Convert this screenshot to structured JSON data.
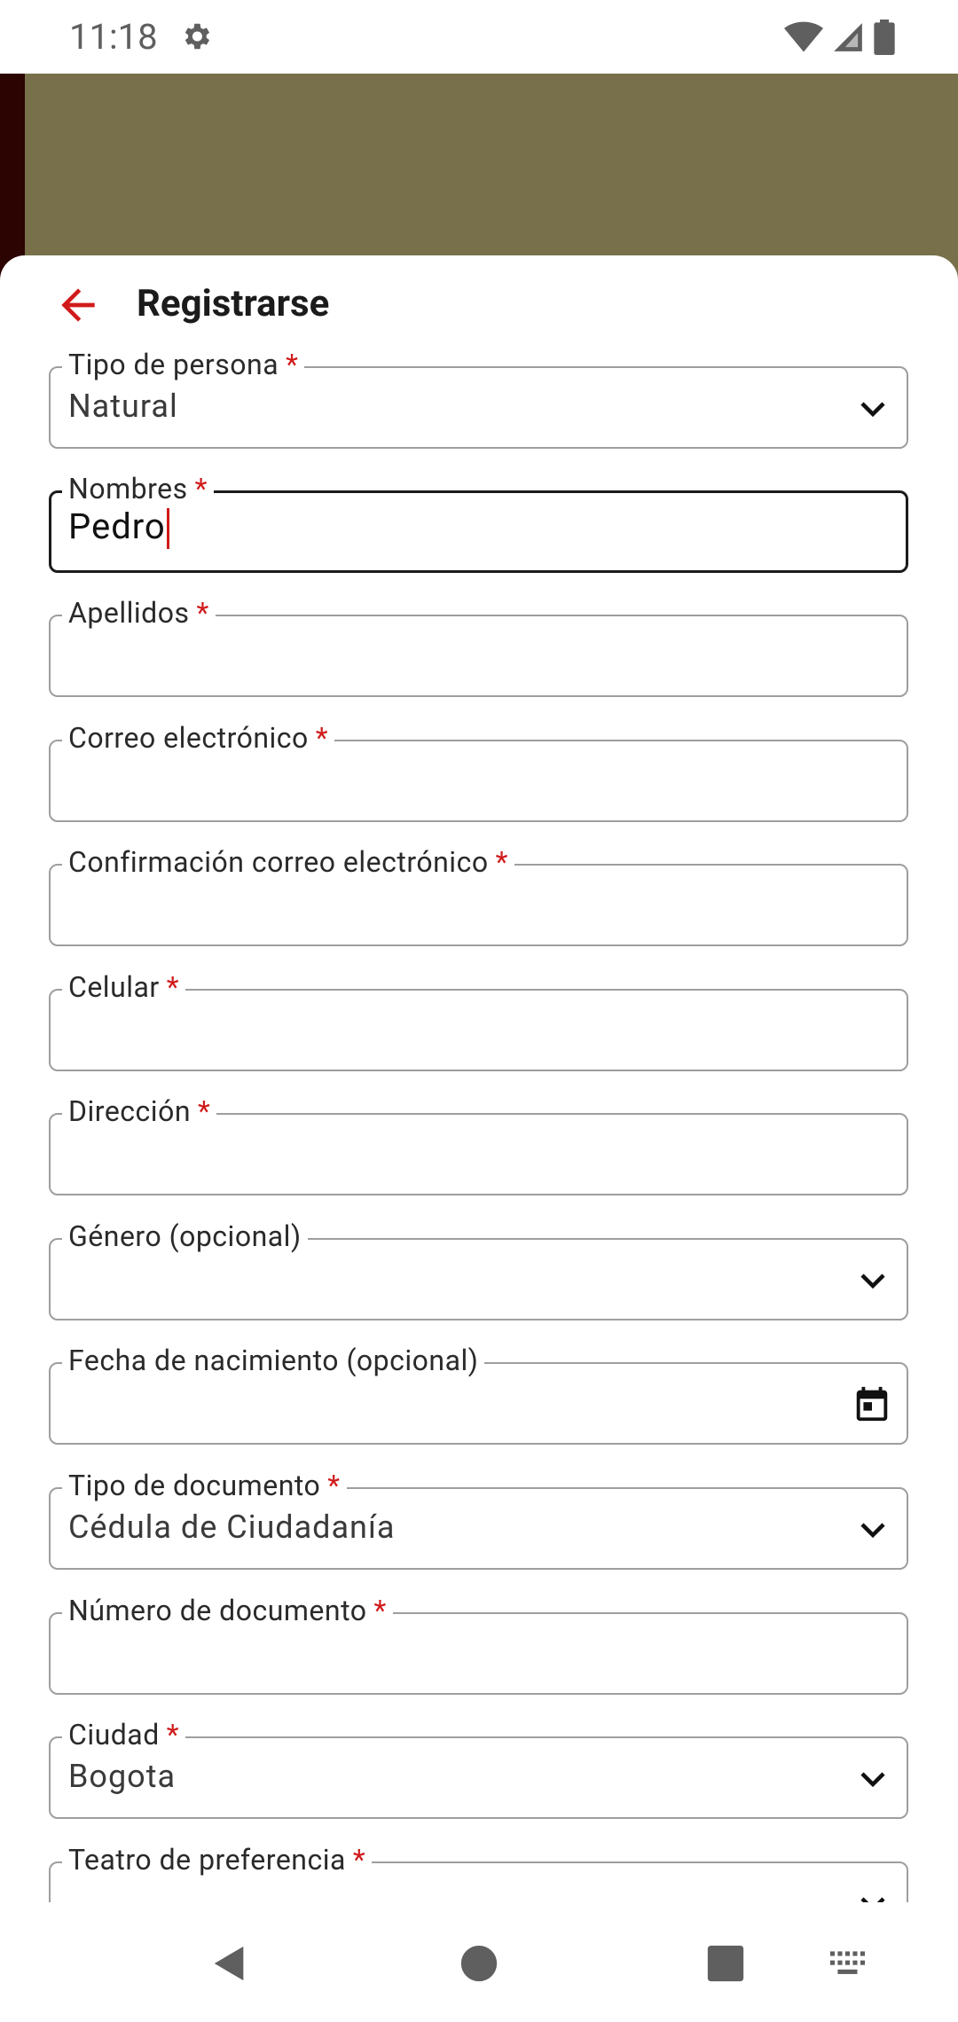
{
  "status_bar": {
    "time": "11:18"
  },
  "header": {
    "title": "Registrarse"
  },
  "required_mark": "*",
  "form": {
    "fields": [
      {
        "label": "Tipo de persona",
        "value": "Natural"
      },
      {
        "label": "Nombres",
        "value": "Pedro"
      },
      {
        "label": "Apellidos",
        "value": ""
      },
      {
        "label": "Correo electrónico",
        "value": ""
      },
      {
        "label": "Confirmación correo electrónico",
        "value": ""
      },
      {
        "label": "Celular",
        "value": ""
      },
      {
        "label": "Dirección",
        "value": ""
      },
      {
        "label": "Género (opcional)",
        "value": ""
      },
      {
        "label": "Fecha de nacimiento (opcional)",
        "value": ""
      },
      {
        "label": "Tipo de documento",
        "value": "Cédula de Ciudadanía"
      },
      {
        "label": "Número de documento",
        "value": ""
      },
      {
        "label": "Ciudad",
        "value": "Bogota"
      },
      {
        "label": "Teatro de preferencia",
        "value": ""
      }
    ]
  },
  "icons": {
    "back": "arrow-left-icon",
    "dropdown": "chevron-down-icon",
    "calendar": "calendar-icon",
    "settings": "gear-icon"
  },
  "colors": {
    "accent": "#d11a1a",
    "backdrop": "#77704a",
    "backdrop_edge": "#2c0402",
    "border": "#9e9e9e",
    "focused_border": "#1b1b1b"
  }
}
